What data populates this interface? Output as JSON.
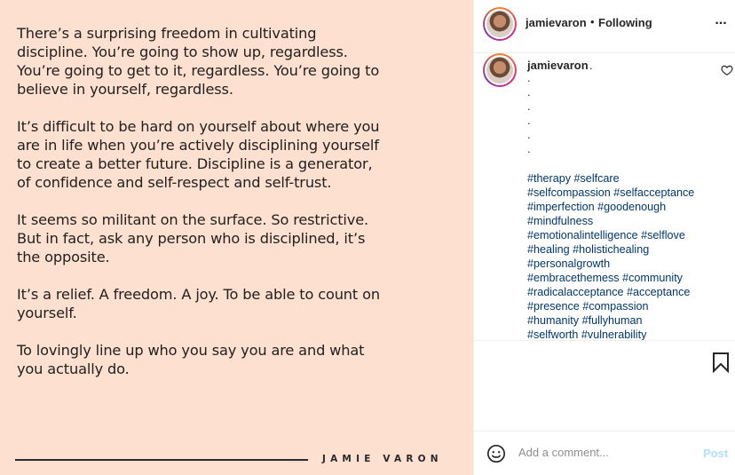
{
  "post_image": {
    "quote_paragraphs": [
      "There’s a surprising freedom in cultivating discipline. You’re going to show up, regardless. You’re going to get to it, regardless. You’re going to believe in yourself, regardless.",
      "It’s difficult to be hard on yourself about where you are in life when you’re actively disciplining yourself to create a better future. Discipline is a generator, of confidence and self-respect and self-trust.",
      "It seems so militant on the surface. So restrictive. But in fact, ask any person who is disciplined, it’s the opposite.",
      "It’s a relief. A freedom. A joy. To be able to count on yourself.",
      "To lovingly line up who you say you are and what you actually do."
    ],
    "signature": "JAMIE VARON",
    "background_color": "#fde0d0"
  },
  "header": {
    "username": "jamievaron",
    "separator": "•",
    "follow_status": "Following",
    "more_icon": "more-horizontal-icon",
    "more_label": "..."
  },
  "caption": {
    "username": "jamievaron",
    "text_start": ".",
    "dots": [
      ".",
      ".",
      ".",
      ".",
      ".",
      "."
    ],
    "hashtag_lines": [
      "#therapy #selfcare",
      "#selfcompassion #selfacceptance",
      "#imperfection #goodenough",
      "#mindfulness",
      "#emotionalintelligence #selflove",
      "#healing #holistichealing",
      "#personalgrowth",
      "#embracethemess #community",
      "#radicalacceptance #acceptance",
      "#presence #compassion",
      "#humanity #fullyhuman",
      "#selfworth #vulnerability"
    ],
    "hashtag_color": "#00376b"
  },
  "actions": {
    "bookmark_icon": "bookmark-icon",
    "like_icon": "heart-icon"
  },
  "comment": {
    "emoji_icon": "emoji-icon",
    "placeholder": "Add a comment...",
    "post_label": "Post",
    "post_color": "#b2dffc"
  }
}
